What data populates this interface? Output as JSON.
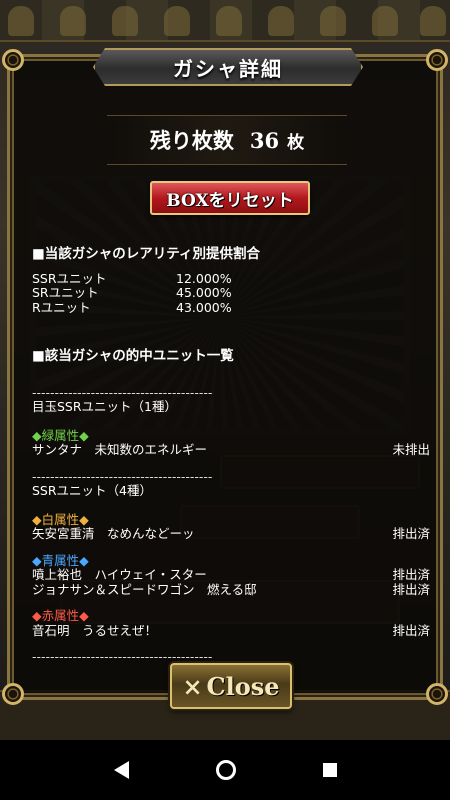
{
  "dialog": {
    "title": "ガシャ詳細",
    "remaining_label": "残り枚数",
    "remaining_count": "36",
    "remaining_unit": "枚",
    "reset_button": "BOXをリセット",
    "close_label": "Close",
    "close_icon": "×"
  },
  "rarity_section": {
    "heading": "■当該ガシャのレアリティ別提供割合",
    "rows": [
      {
        "name": "SSRユニット",
        "rate": "12.000%"
      },
      {
        "name": "SRユニット",
        "rate": "45.000%"
      },
      {
        "name": "Rユニット",
        "rate": "43.000%"
      }
    ]
  },
  "hit_section": {
    "heading": "■該当ガシャの的中ユニット一覧",
    "divider": "----------------------------------------",
    "featured_heading": "目玉SSRユニット（1種）",
    "ssr_heading": "SSRユニット（4種）",
    "groups": [
      {
        "attribute": "◆緑属性◆",
        "units": [
          {
            "name": "サンタナ　未知数のエネルギー",
            "status": "未排出"
          }
        ]
      },
      {
        "attribute": "◆白属性◆",
        "units": [
          {
            "name": "矢安宮重清　なめんなどーッ",
            "status": "排出済"
          }
        ]
      },
      {
        "attribute": "◆青属性◆",
        "units": [
          {
            "name": "噴上裕也　ハイウェイ・スター",
            "status": "排出済"
          },
          {
            "name": "ジョナサン＆スピードワゴン　燃える邸",
            "status": "排出済"
          }
        ]
      },
      {
        "attribute": "◆赤属性◆",
        "units": [
          {
            "name": "音石明　うるせえぜ！",
            "status": "排出済"
          }
        ]
      }
    ]
  },
  "colors": {
    "frame_gold": "#8a7440",
    "reset_red": "#b2181d",
    "green_attr": "#6fd24a",
    "white_attr": "#f0b040",
    "blue_attr": "#4aa8ff",
    "red_attr": "#ff5a48"
  },
  "system_nav": {
    "back_icon": "back-triangle-icon",
    "home_icon": "home-circle-icon",
    "recent_icon": "recent-square-icon"
  }
}
